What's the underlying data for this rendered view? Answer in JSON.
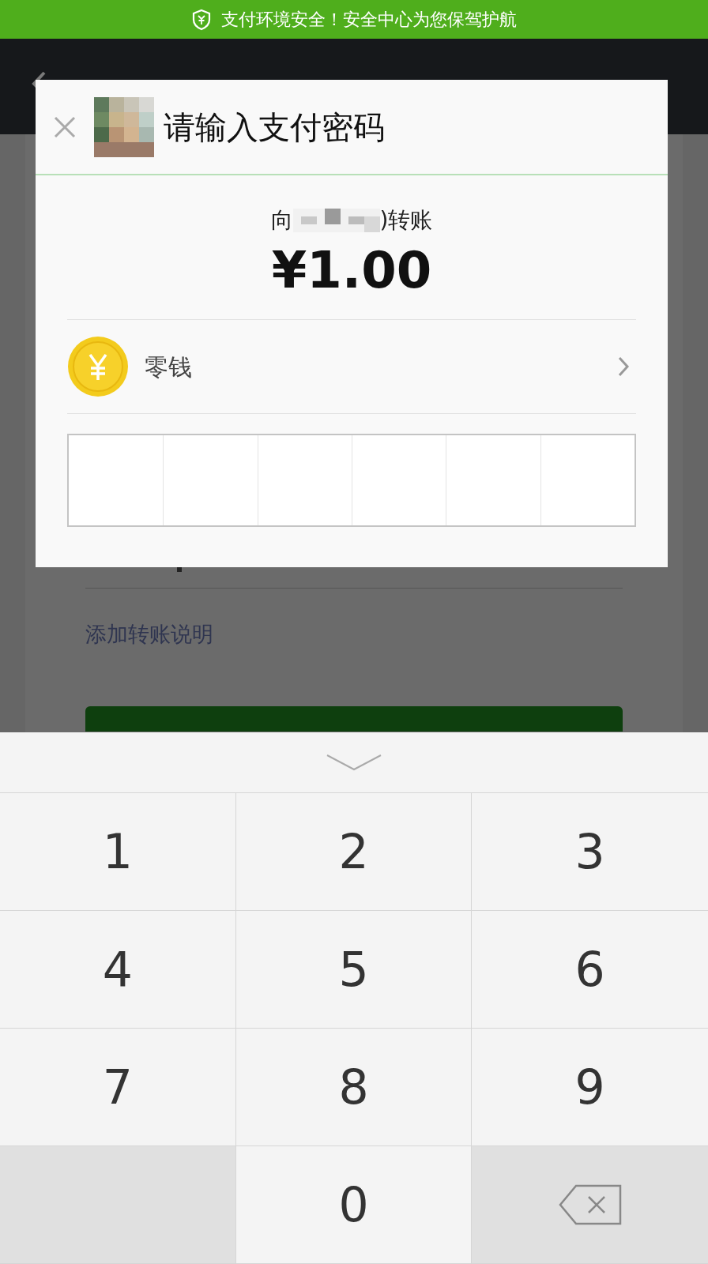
{
  "banner": {
    "text": "支付环境安全！安全中心为您保驾护航"
  },
  "form": {
    "note_link": "添加转账说明"
  },
  "dialog": {
    "title": "请输入支付密码",
    "recipient_prefix": "向",
    "recipient_suffix": ")转账",
    "amount": "¥1.00",
    "payment_method": "零钱",
    "password_cells": [
      {
        "filled": false
      },
      {
        "filled": false
      },
      {
        "filled": false
      },
      {
        "filled": false
      },
      {
        "filled": false
      },
      {
        "filled": false
      }
    ]
  },
  "keypad": {
    "keys": [
      {
        "kind": "digit",
        "label": "1"
      },
      {
        "kind": "digit",
        "label": "2"
      },
      {
        "kind": "digit",
        "label": "3"
      },
      {
        "kind": "digit",
        "label": "4"
      },
      {
        "kind": "digit",
        "label": "5"
      },
      {
        "kind": "digit",
        "label": "6"
      },
      {
        "kind": "digit",
        "label": "7"
      },
      {
        "kind": "digit",
        "label": "8"
      },
      {
        "kind": "digit",
        "label": "9"
      },
      {
        "kind": "blank"
      },
      {
        "kind": "digit",
        "label": "0"
      },
      {
        "kind": "delete"
      }
    ]
  }
}
